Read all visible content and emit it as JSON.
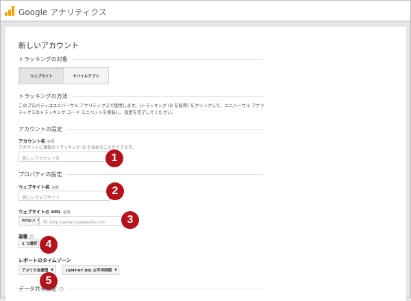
{
  "header": {
    "brand_google": "Google",
    "brand_product": "アナリティクス"
  },
  "page_title": "新しいアカウント",
  "tracking_target": {
    "heading": "トラッキングの対象",
    "options": [
      "ウェブサイト",
      "モバイルアプリ"
    ],
    "selected": "ウェブサイト"
  },
  "tracking_method": {
    "heading": "トラッキングの方法",
    "description": "このプロパティはユニバーサル アナリティクスで使用します。[トラッキング ID を取得] をクリックして、ユニバーサル アナリティクスのトラッキング コード スニペットを実装し、設定を完了してください。"
  },
  "account": {
    "heading": "アカウントの設定",
    "name_label": "アカウント名",
    "required": "必須",
    "hint": "アカウントに複数のトラッキング ID を含めることができます。",
    "name_placeholder": "新しいアカウント名"
  },
  "property": {
    "heading": "プロパティの設定",
    "site_name_label": "ウェブサイト名",
    "site_name_placeholder": "新しいウェブサイト",
    "url_label": "ウェブサイトの URL",
    "protocol": "http://",
    "url_placeholder": "例: http://www.mywebsite.com",
    "industry_label": "業種",
    "industry_value": "1 つ選択",
    "timezone_label": "レポートのタイムゾーン",
    "country": "アメリカ合衆国",
    "timezone": "(GMT-07:00) 太平洋時間"
  },
  "data_sharing": {
    "heading": "データ共有設定"
  },
  "badges": [
    "1",
    "2",
    "3",
    "4",
    "5"
  ],
  "colors": {
    "badge": "#b5121b",
    "logo": "#f4a000"
  }
}
